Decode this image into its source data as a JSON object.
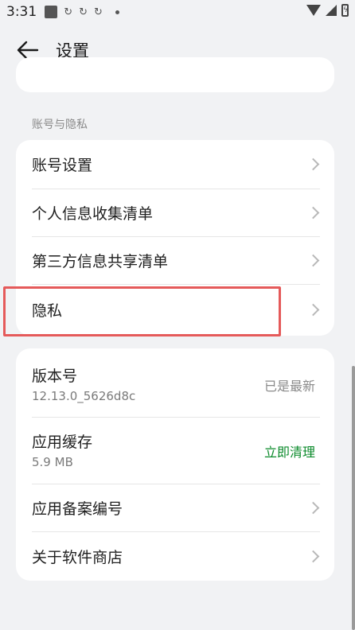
{
  "status_bar": {
    "time": "3:31"
  },
  "header": {
    "title": "设置"
  },
  "section": {
    "header": "账号与隐私"
  },
  "account_card": {
    "items": [
      {
        "label": "账号设置"
      },
      {
        "label": "个人信息收集清单"
      },
      {
        "label": "第三方信息共享清单"
      },
      {
        "label": "隐私"
      }
    ]
  },
  "about_card": {
    "version": {
      "label": "版本号",
      "value": "12.13.0_5626d8c",
      "status": "已是最新"
    },
    "cache": {
      "label": "应用缓存",
      "value": "5.9 MB",
      "action": "立即清理"
    },
    "filing": {
      "label": "应用备案编号"
    },
    "about": {
      "label": "关于软件商店"
    }
  },
  "colors": {
    "accent_green": "#0a8a2a",
    "highlight_red": "#e55a5a"
  },
  "icons": [
    "photo-icon",
    "sync-icon",
    "wifi-icon",
    "signal-icon",
    "battery-icon",
    "back-arrow-icon",
    "chevron-right-icon"
  ]
}
